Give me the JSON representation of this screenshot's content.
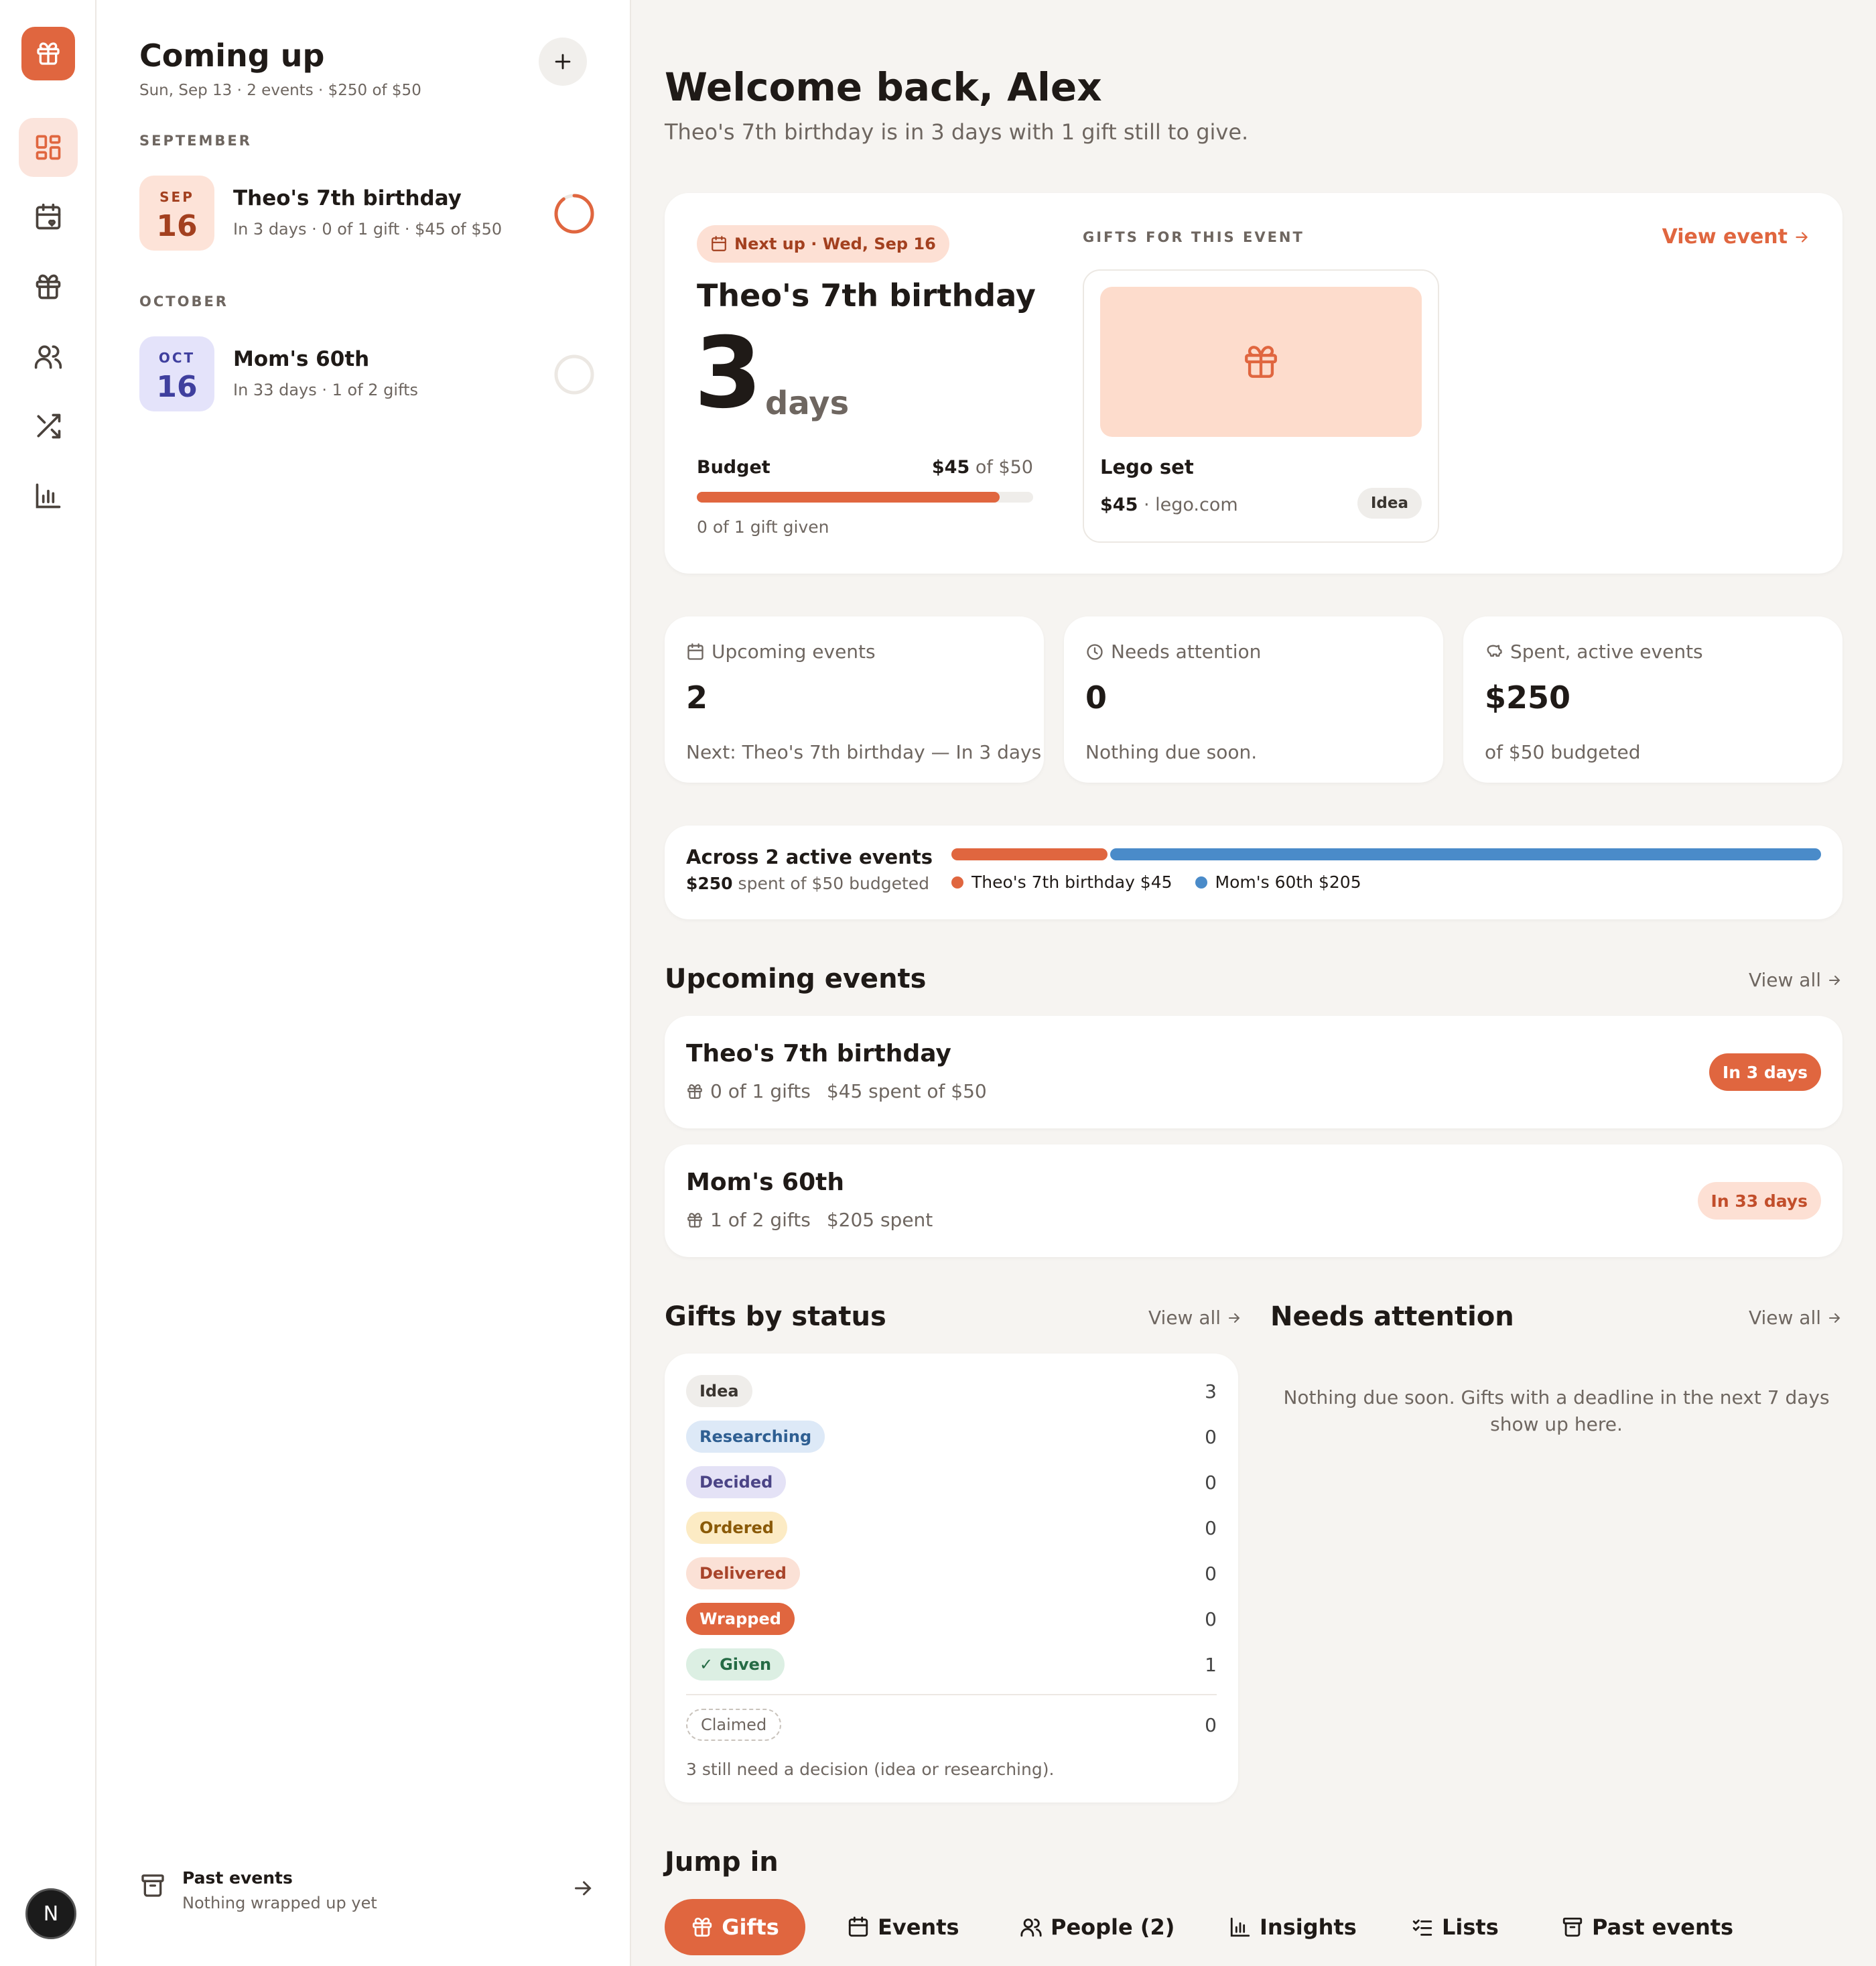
{
  "colors": {
    "accent": "#e0663f",
    "blue": "#4a8bc9"
  },
  "rail": {
    "logo_icon": "gift-icon",
    "items": [
      {
        "icon": "dashboard-icon",
        "active": true
      },
      {
        "icon": "calendar-heart-icon"
      },
      {
        "icon": "gift-icon"
      },
      {
        "icon": "users-icon"
      },
      {
        "icon": "shuffle-icon"
      },
      {
        "icon": "bar-chart-icon"
      }
    ],
    "avatar": "N"
  },
  "sidebar": {
    "title": "Coming up",
    "subtitle": "Sun, Sep 13 · 2 events · $250 of $50",
    "groups": [
      {
        "month": "SEPTEMBER",
        "events": [
          {
            "mon": "SEP",
            "day": "16",
            "name": "Theo's 7th birthday",
            "meta": "In 3 days · 0 of 1 gift · $45 of $50",
            "progress": 0.9
          }
        ]
      },
      {
        "month": "OCTOBER",
        "events": [
          {
            "mon": "OCT",
            "day": "16",
            "name": "Mom's 60th",
            "meta": "In 33 days · 1 of 2 gifts",
            "progress": 0
          }
        ]
      }
    ],
    "past": {
      "title": "Past events",
      "subtitle": "Nothing wrapped up yet"
    }
  },
  "header": {
    "title": "Welcome back, Alex",
    "subtitle": "Theo's 7th birthday is in 3 days with 1 gift still to give."
  },
  "hero": {
    "badge": "Next up · Wed, Sep 16",
    "event_name": "Theo's 7th birthday",
    "days_num": "3",
    "days_label": "days",
    "budget_label": "Budget",
    "budget_spent": "$45",
    "budget_of": "of $50",
    "budget_progress": 0.9,
    "given": "0 of 1 gift given",
    "gifts_label": "GIFTS FOR THIS EVENT",
    "view_event": "View event",
    "gift": {
      "name": "Lego set",
      "price": "$45",
      "source": "lego.com",
      "status": "Idea"
    }
  },
  "stats": [
    {
      "icon": "calendar-heart-icon",
      "label": "Upcoming events",
      "value": "2",
      "foot": "Next: Theo's 7th birthday — In 3 days"
    },
    {
      "icon": "clock-icon",
      "label": "Needs attention",
      "value": "0",
      "foot": "Nothing due soon."
    },
    {
      "icon": "piggy-bank-icon",
      "label": "Spent, active events",
      "value": "$250",
      "foot": "of $50 budgeted"
    }
  ],
  "spend": {
    "title": "Across 2 active events",
    "amount": "$250",
    "rest": "spent of $50 budgeted",
    "segments": [
      {
        "label": "Theo's 7th birthday $45",
        "value": 45,
        "color": "#e0663f"
      },
      {
        "label": "Mom's 60th $205",
        "value": 205,
        "color": "#4a8bc9"
      }
    ]
  },
  "upcoming": {
    "title": "Upcoming events",
    "view_all": "View all",
    "items": [
      {
        "name": "Theo's 7th birthday",
        "gifts": "0 of 1 gifts",
        "spent": "$45 spent of $50",
        "badge": "In 3 days",
        "badge_style": "solid"
      },
      {
        "name": "Mom's 60th",
        "gifts": "1 of 2 gifts",
        "spent": "$205 spent",
        "badge": "In 33 days",
        "badge_style": "soft"
      }
    ]
  },
  "gifts_status": {
    "title": "Gifts by status",
    "view_all": "View all",
    "rows": [
      {
        "label": "Idea",
        "count": "3",
        "bg": "#efedea",
        "fg": "#3a3530"
      },
      {
        "label": "Researching",
        "count": "0",
        "bg": "#dde9f7",
        "fg": "#2f5f92"
      },
      {
        "label": "Decided",
        "count": "0",
        "bg": "#e4e2f6",
        "fg": "#4b4486"
      },
      {
        "label": "Ordered",
        "count": "0",
        "bg": "#fcebc4",
        "fg": "#8a5a08"
      },
      {
        "label": "Delivered",
        "count": "0",
        "bg": "#fbe1d6",
        "fg": "#a8442a"
      },
      {
        "label": "Wrapped",
        "count": "0",
        "bg": "#e0663f",
        "fg": "#ffffff"
      },
      {
        "label": "Given",
        "count": "1",
        "bg": "#dcefe3",
        "fg": "#256b45",
        "check": true
      }
    ],
    "claimed": {
      "label": "Claimed",
      "count": "0"
    },
    "note": "3 still need a decision (idea or researching)."
  },
  "attention": {
    "title": "Needs attention",
    "view_all": "View all",
    "empty_line1": "Nothing due soon. Gifts with a deadline in the next 7 days",
    "empty_line2": "show up here."
  },
  "jump": {
    "title": "Jump in",
    "items": [
      {
        "label": "Gifts",
        "icon": "gift-icon",
        "active": true
      },
      {
        "label": "Events",
        "icon": "calendar-heart-icon"
      },
      {
        "label": "People (2)",
        "icon": "users-icon"
      },
      {
        "label": "Insights",
        "icon": "bar-chart-icon"
      },
      {
        "label": "Lists",
        "icon": "list-checks-icon"
      },
      {
        "label": "Past events",
        "icon": "archive-icon"
      }
    ]
  }
}
